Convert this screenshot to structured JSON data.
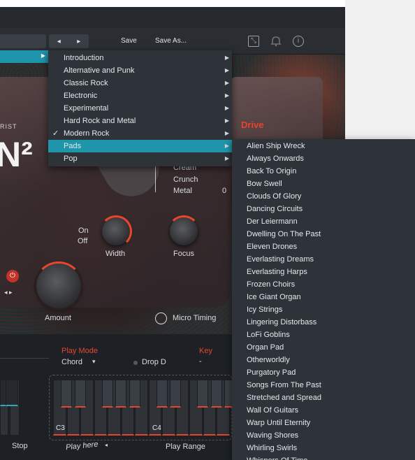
{
  "toolbar": {
    "nav_prev": "◂",
    "nav_next": "▸",
    "save": "Save",
    "save_as": "Save As..."
  },
  "instrument": {
    "artist_suffix": "RIST",
    "logo": "N²",
    "drive_label": "Drive"
  },
  "tone": {
    "options": [
      "Cream",
      "Crunch",
      "Metal"
    ],
    "selected": "Metal",
    "value": "0"
  },
  "width": {
    "on": "On",
    "off": "Off",
    "label": "Width"
  },
  "focus": {
    "label": "Focus"
  },
  "amount": {
    "label": "Amount"
  },
  "micro_timing": {
    "label": "Micro Timing"
  },
  "play_mode": {
    "label": "Play Mode",
    "value": "Chord"
  },
  "drop": {
    "label": "Drop D"
  },
  "key": {
    "label": "Key",
    "value": "-"
  },
  "keyboard": {
    "c3": "C3",
    "c4": "C4",
    "stop": "Stop",
    "play_here": "Play here",
    "play_range": "Play Range"
  },
  "menu": {
    "items": [
      {
        "label": "Introduction"
      },
      {
        "label": "Alternative and Punk"
      },
      {
        "label": "Classic Rock"
      },
      {
        "label": "Electronic"
      },
      {
        "label": "Experimental"
      },
      {
        "label": "Hard Rock and Metal"
      },
      {
        "label": "Modern Rock",
        "checked": true
      },
      {
        "label": "Pads",
        "selected": true
      },
      {
        "label": "Pop"
      }
    ]
  },
  "submenu": {
    "items": [
      "Alien Ship Wreck",
      "Always Onwards",
      "Back To Origin",
      "Bow Swell",
      "Clouds Of Glory",
      "Dancing Circuits",
      "Der Leiermann",
      "Dwelling On The Past",
      "Eleven Drones",
      "Everlasting Dreams",
      "Everlasting Harps",
      "Frozen Choirs",
      "Ice Giant Organ",
      "Icy Strings",
      "Lingering Distorbass",
      "LoFi Goblins",
      "Organ Pad",
      "Otherworldly",
      "Purgatory Pad",
      "Songs From The Past",
      "Stretched and Spread",
      "Wall Of Guitars",
      "Warp Until Eternity",
      "Waving Shores",
      "Whirling Swirls",
      "Whispers Of Time"
    ]
  },
  "colors": {
    "accent": "#1f95ab",
    "red": "#e8452f"
  }
}
